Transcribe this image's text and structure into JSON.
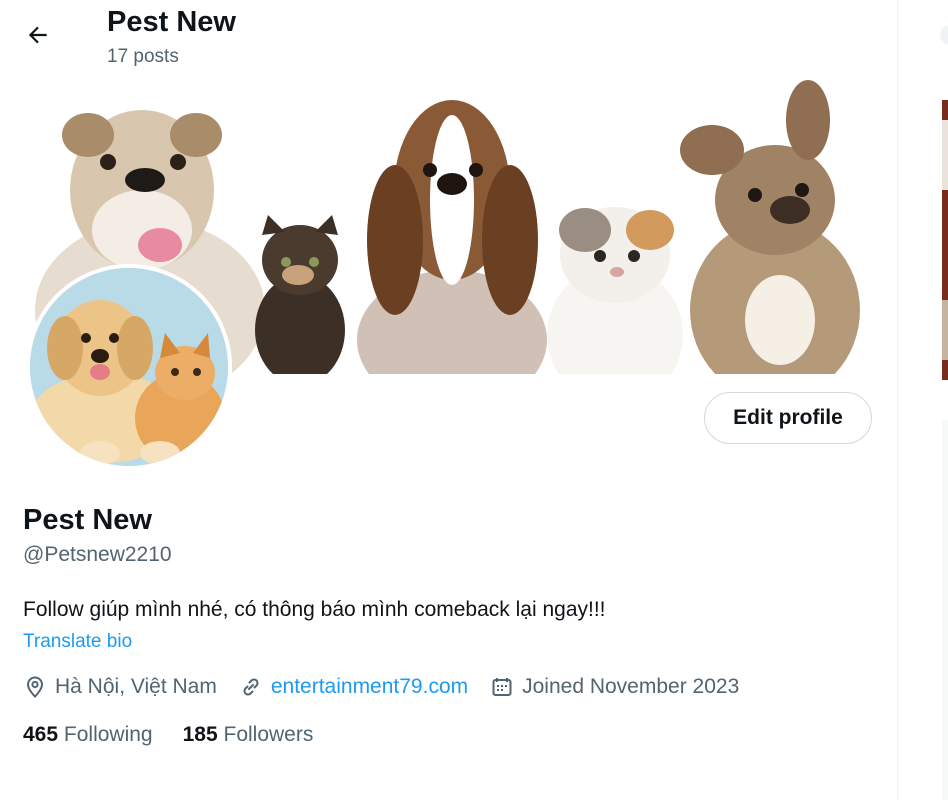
{
  "header": {
    "title": "Pest New",
    "post_count": "17 posts"
  },
  "profile": {
    "display_name": "Pest New",
    "handle": "@Petsnew2210",
    "bio": "Follow giúp mình nhé, có thông báo mình comeback lại ngay!!!",
    "translate_label": "Translate bio",
    "edit_label": "Edit profile",
    "location": "Hà Nội, Việt Nam",
    "website": "entertainment79.com",
    "joined": "Joined November 2023",
    "following_count": "465",
    "following_label": "Following",
    "followers_count": "185",
    "followers_label": "Followers"
  },
  "icons": {
    "back": "arrow-left-icon",
    "location": "map-pin-icon",
    "website": "link-icon",
    "joined": "calendar-icon"
  },
  "colors": {
    "accent": "#1d9bf0",
    "secondary_text": "#536471",
    "primary_text": "#0f1419",
    "border": "#cfd9de"
  }
}
